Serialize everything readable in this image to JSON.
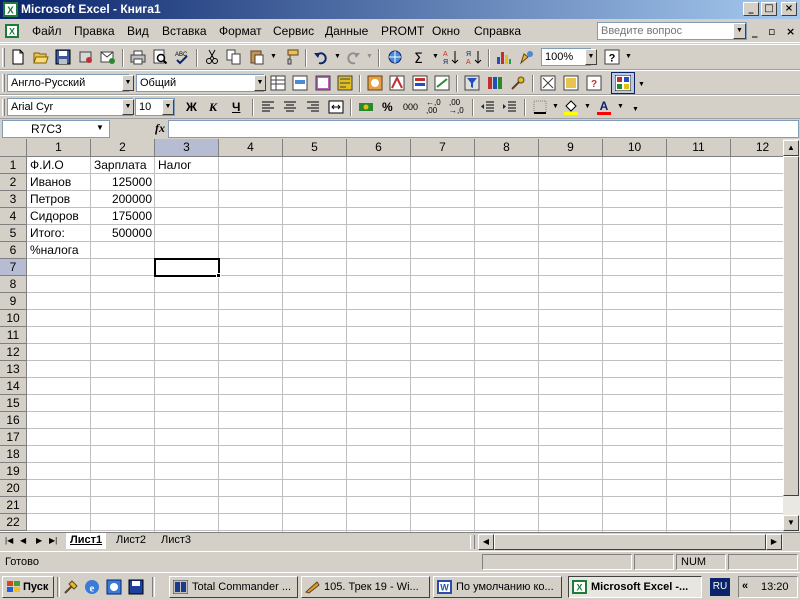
{
  "window": {
    "title": "Microsoft Excel - Книга1"
  },
  "title_buttons": [
    "_",
    "□",
    "×"
  ],
  "menu": {
    "items": [
      {
        "label": "Файл"
      },
      {
        "label": "Правка"
      },
      {
        "label": "Вид"
      },
      {
        "label": "Вставка"
      },
      {
        "label": "Формат"
      },
      {
        "label": "Сервис"
      },
      {
        "label": "Данные"
      },
      {
        "label": "PROMT"
      },
      {
        "label": "Окно"
      },
      {
        "label": "Справка"
      }
    ],
    "help_placeholder": "Введите вопрос",
    "mdi_buttons": [
      "_",
      "▫",
      "×"
    ]
  },
  "standard_toolbar": {
    "zoom": "100%",
    "icons": [
      "new-icon",
      "open-icon",
      "save-icon",
      "permission-icon",
      "email-icon",
      "print-icon",
      "print-preview-icon",
      "spelling-icon",
      "cut-icon",
      "copy-icon",
      "paste-icon",
      "format-painter-icon",
      "undo-icon",
      "redo-icon",
      "hyperlink-icon",
      "autosum-icon",
      "sort-asc-icon",
      "sort-desc-icon",
      "chart-wizard-icon",
      "drawing-icon",
      "help-icon"
    ]
  },
  "promt_toolbar": {
    "direction": "Англо-Русский",
    "subject": "Общий"
  },
  "formatting_toolbar": {
    "font": "Arial Cyr",
    "size": "10",
    "bold": "Ж",
    "italic": "К",
    "underline": "Ч"
  },
  "formula_bar": {
    "name_box": "R7C3",
    "fx": "fx",
    "formula": ""
  },
  "sheet": {
    "columns": [
      "1",
      "2",
      "3",
      "4",
      "5",
      "6",
      "7",
      "8",
      "9",
      "10",
      "11",
      "12"
    ],
    "rows": [
      "1",
      "2",
      "3",
      "4",
      "5",
      "6",
      "7",
      "8",
      "9",
      "10",
      "11",
      "12",
      "13",
      "14",
      "15",
      "16",
      "17",
      "18",
      "19",
      "20",
      "21",
      "22"
    ],
    "cells": [
      [
        "Ф.И.О",
        "Зарплата",
        "Налог"
      ],
      [
        "Иванов",
        "125000",
        ""
      ],
      [
        "Петров",
        "200000",
        ""
      ],
      [
        "Сидоров",
        "175000",
        ""
      ],
      [
        "Итого:",
        "500000",
        ""
      ],
      [
        "%налога",
        "",
        ""
      ]
    ],
    "active_cell": "R7C3"
  },
  "sheet_tabs": [
    {
      "label": "Лист1",
      "active": true
    },
    {
      "label": "Лист2",
      "active": false
    },
    {
      "label": "Лист3",
      "active": false
    }
  ],
  "status": {
    "text": "Готово",
    "num": "NUM"
  },
  "taskbar": {
    "start": "Пуск",
    "tasks": [
      {
        "label": "Total Commander ...",
        "active": false
      },
      {
        "label": "105. Трек 19 - Wi...",
        "active": false
      },
      {
        "label": "По умолчанию ко...",
        "active": false
      },
      {
        "label": "Microsoft Excel -...",
        "active": true
      }
    ],
    "lang": "RU",
    "time": "13:20"
  },
  "colors": {
    "title_start": "#0a246a",
    "title_end": "#a6caf0",
    "excel_green": "#1d7a3a",
    "selection_header": "#b6bdd2"
  }
}
